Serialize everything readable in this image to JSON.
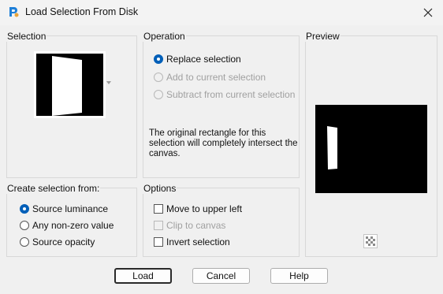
{
  "window": {
    "title": "Load Selection From Disk",
    "icon": "paintshop-pro-icon"
  },
  "selection_group": {
    "title": "Selection"
  },
  "operation_group": {
    "title": "Operation",
    "options": [
      {
        "label": "Replace selection",
        "checked": true,
        "enabled": true
      },
      {
        "label": "Add to current selection",
        "checked": false,
        "enabled": false
      },
      {
        "label": "Subtract from current selection",
        "checked": false,
        "enabled": false
      }
    ],
    "info": "The original rectangle for this selection will completely intersect the canvas."
  },
  "preview_group": {
    "title": "Preview"
  },
  "create_group": {
    "title": "Create selection from:",
    "options": [
      {
        "label": "Source luminance",
        "checked": true
      },
      {
        "label": "Any non-zero value",
        "checked": false
      },
      {
        "label": "Source opacity",
        "checked": false
      }
    ]
  },
  "options_group": {
    "title": "Options",
    "items": [
      {
        "label": "Move to upper left",
        "checked": false,
        "enabled": true
      },
      {
        "label": "Clip to canvas",
        "checked": false,
        "enabled": false
      },
      {
        "label": "Invert selection",
        "checked": false,
        "enabled": true
      }
    ]
  },
  "buttons": {
    "load": "Load",
    "cancel": "Cancel",
    "help": "Help"
  },
  "colors": {
    "accent": "#005fb8",
    "disabled_text": "#a0a0a0",
    "preview_bg": "#000000"
  }
}
